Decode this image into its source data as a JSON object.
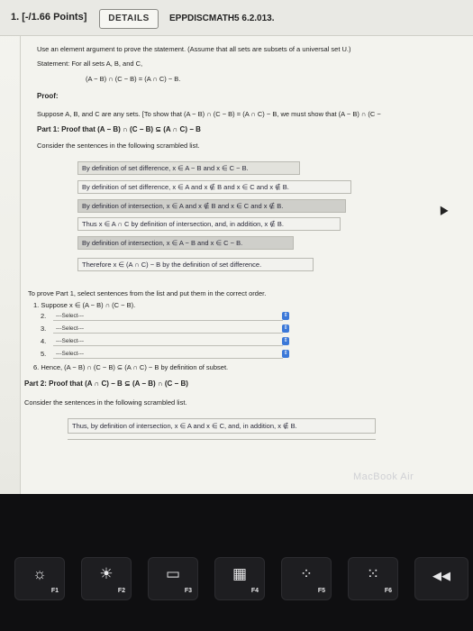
{
  "header": {
    "question_number": "1. [-/1.66 Points]",
    "details_label": "DETAILS",
    "problem_code": "EPPDISCMATH5 6.2.013."
  },
  "intro": {
    "instruction": "Use an element argument to prove the statement. (Assume that all sets are subsets of a universal set U.)",
    "statement_label": "Statement: For all sets A, B, and C,",
    "statement_formula": "(A − B) ∩ (C − B) = (A ∩ C) − B."
  },
  "proof": {
    "label": "Proof:",
    "suppose_text": "Suppose A, B, and C are any sets. [To show that (A − B) ∩ (C − B) = (A ∩ C) − B, we must show that (A − B) ∩ (C −",
    "part1_heading": "Part 1: Proof that (A − B) ∩ (C − B) ⊆ (A ∩ C) − B",
    "scrambled_intro": "Consider the sentences in the following scrambled list."
  },
  "scrambled_list_1": [
    "By definition of set difference, x ∈ A − B and x ∈ C − B.",
    "By definition of set difference, x ∈ A and x ∉ B and x ∈ C and x ∉ B.",
    "By definition of intersection, x ∈ A and x ∉ B and x ∈ C and x ∉ B.",
    "Thus x ∈ A ∩ C by definition of intersection, and, in addition, x ∉ B.",
    "By definition of intersection, x ∈ A − B and x ∈ C − B.",
    "Therefore x ∈ (A ∩ C) − B by the definition of set difference."
  ],
  "part1_steps": {
    "instruction": "To prove Part 1, select sentences from the list and put them in the correct order.",
    "step1": "1. Suppose x ∈ (A − B) ∩ (C − B).",
    "selects": [
      {
        "num": "2.",
        "value": "---Select---"
      },
      {
        "num": "3.",
        "value": "---Select---"
      },
      {
        "num": "4.",
        "value": "---Select---"
      },
      {
        "num": "5.",
        "value": "---Select---"
      }
    ],
    "step6": "6. Hence, (A − B) ∩ (C − B) ⊆ (A ∩ C) − B by definition of subset."
  },
  "part2": {
    "heading": "Part 2: Proof that (A ∩ C) − B ⊆ (A − B) ∩ (C − B)",
    "scrambled_intro": "Consider the sentences in the following scrambled list.",
    "first_sentence": "Thus, by definition of intersection, x ∈ A and x ∈ C, and, in addition, x ∉ B."
  },
  "brand": "MacBook Air",
  "keys": [
    {
      "name": "f1",
      "symbol": "☼",
      "label": "F1"
    },
    {
      "name": "f2",
      "symbol": "☀",
      "label": "F2"
    },
    {
      "name": "f3",
      "symbol": "▭",
      "label": "F3"
    },
    {
      "name": "f4",
      "symbol": "▦",
      "label": "F4"
    },
    {
      "name": "f5",
      "symbol": "⁘",
      "label": "F5"
    },
    {
      "name": "f6",
      "symbol": "⁙",
      "label": "F6"
    },
    {
      "name": "f7",
      "symbol": "◀◀",
      "label": ""
    }
  ],
  "colors": {
    "select_arrow": "#3b78d8",
    "sentence_bg": "#e2e2dc",
    "keyboard": "#0f0f11"
  }
}
